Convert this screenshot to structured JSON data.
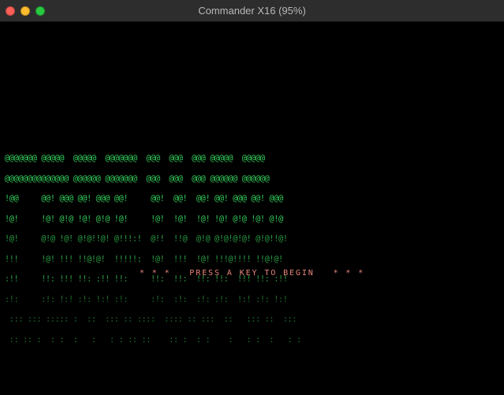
{
  "window": {
    "title": "Commander X16 (95%)"
  },
  "screen": {
    "logo_rows": [
      "@@@@@@@ @@@@@  @@@@@  @@@@@@@  @@@  @@@  @@@ @@@@@  @@@@@",
      "@@@@@@@@@@@@@@ @@@@@@ @@@@@@@  @@@  @@@  @@@ @@@@@@ @@@@@@",
      "!@@     @@! @@@ @@! @@@ @@!     @@!  @@!  @@! @@! @@@ @@! @@@",
      "!@!     !@! @!@ !@! @!@ !@!     !@!  !@!  !@! !@! @!@ !@! @!@",
      "!@!     @!@ !@! @!@!!@! @!!!:!  @!!  !!@  @!@ @!@!@!@! @!@!!@!",
      "!!!     !@! !!! !!@!@!  !!!!!:  !@!  !!!  !@! !!!@!!!! !!@!@!",
      ":!!     !!: !!! !!: :!! !!:     !!:  !!:  !!: !!:  !!! !!: :!!",
      ":!:     :!: !:! :!: !:! :!:     :!:  :!:  :!: :!:  !:! :!: !:!",
      " ::: ::: ::::: :  ::  ::: :: ::::  :::: :: :::  ::   ::: ::  :::",
      " :: :: :  : :  :   :   : : :: ::    :: :  : :    :   : :  :   : :"
    ],
    "prompt": "* * *   PRESS A KEY TO BEGIN   * * *"
  },
  "colors": {
    "background": "#000000",
    "titlebar": "#2d2d2d",
    "title_text": "#b9b9b9",
    "close_button": "#fe5f57",
    "minimize_button": "#febc2e",
    "zoom_button": "#28c840",
    "logo_bright": "#33cc5a",
    "logo_mid": "#2a9e44",
    "logo_dim": "#1d6e2e",
    "prompt_text": "#e8857a"
  },
  "icons": {
    "close": "close-icon",
    "minimize": "minimize-icon",
    "zoom": "zoom-icon"
  }
}
